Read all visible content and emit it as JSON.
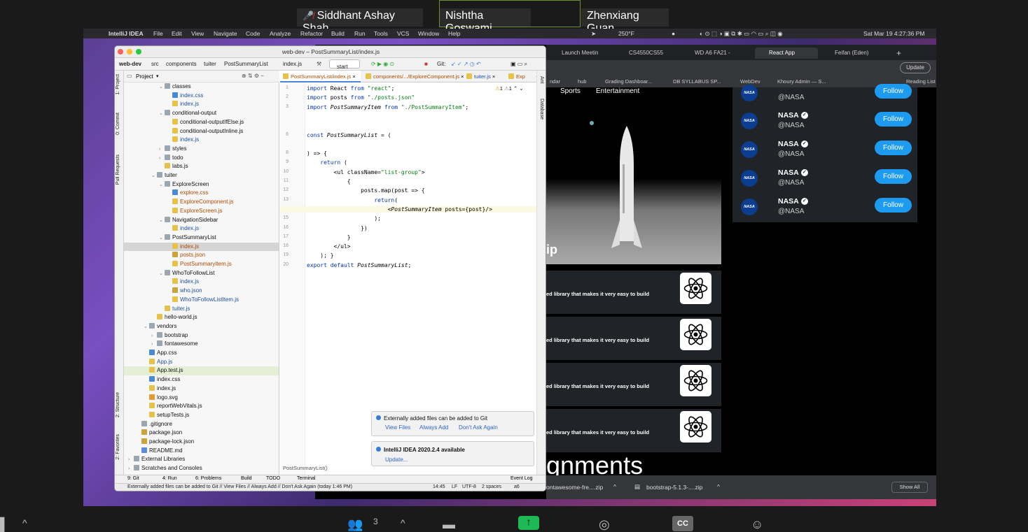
{
  "participants": [
    "Siddhant Ashay Shah",
    "Nishtha Goswami",
    "Zhenxiang Guan"
  ],
  "menubar": {
    "app": "IntelliJ IDEA",
    "items": [
      "File",
      "Edit",
      "View",
      "Navigate",
      "Code",
      "Analyze",
      "Refactor",
      "Build",
      "Run",
      "Tools",
      "VCS",
      "Window",
      "Help"
    ],
    "temp": "250°F",
    "clock": "Sat Mar 19  4:27:36 PM"
  },
  "chrome": {
    "tabs": [
      "Launch Meetin",
      "CS4550CS55",
      "WD A6 FA21 -",
      "React App",
      "Feifan (Eden)"
    ],
    "update": "Update",
    "bookmarks": [
      "ndar",
      "hub",
      "Grading Dashboar...",
      "DB SYLLABUS SP...",
      "WebDev",
      "Khoury Admin — S...",
      "Reading List"
    ],
    "nav_items": [
      "Sports",
      "Entertainment"
    ],
    "heading_fragment": "ip",
    "assign_fragment": "gnments",
    "react_text": "ed library that makes it very easy to build",
    "who": [
      {
        "name": "NASA",
        "handle": "@NASA",
        "follow": "Follow"
      },
      {
        "name": "NASA",
        "handle": "@NASA",
        "follow": "Follow"
      },
      {
        "name": "NASA",
        "handle": "@NASA",
        "follow": "Follow"
      },
      {
        "name": "NASA",
        "handle": "@NASA",
        "follow": "Follow"
      },
      {
        "name": "NASA",
        "handle": "@NASA",
        "follow": "Follow"
      }
    ],
    "nasa_logo_text": "NASA",
    "downloads": [
      "ontawesome-fre....zip",
      "bootstrap-5.1.3-....zip"
    ],
    "show_all": "Show All"
  },
  "ij": {
    "title": "web-dev – PostSummaryList/index.js",
    "breadcrumb": [
      "web-dev",
      "src",
      "components",
      "tuiter",
      "PostSummaryList",
      "index.js"
    ],
    "run_config": "start",
    "git_label": "Git:",
    "project_label": "Project",
    "tree": [
      {
        "label": "classes",
        "type": "folder",
        "indent": 4,
        "open": true
      },
      {
        "label": "index.css",
        "type": "css",
        "indent": 5,
        "color": "#2050a0"
      },
      {
        "label": "index.js",
        "type": "js",
        "indent": 5,
        "color": "#2050a0"
      },
      {
        "label": "conditional-output",
        "type": "folder",
        "indent": 4,
        "open": true
      },
      {
        "label": "conditional-outputIfElse.js",
        "type": "js",
        "indent": 5
      },
      {
        "label": "conditional-outputInline.js",
        "type": "js",
        "indent": 5
      },
      {
        "label": "index.js",
        "type": "js",
        "indent": 5,
        "color": "#2050a0"
      },
      {
        "label": "styles",
        "type": "folder",
        "indent": 4,
        "open": false
      },
      {
        "label": "todo",
        "type": "folder",
        "indent": 4,
        "open": false
      },
      {
        "label": "labs.js",
        "type": "js",
        "indent": 4
      },
      {
        "label": "tuiter",
        "type": "folder",
        "indent": 3,
        "open": true
      },
      {
        "label": "ExploreScreen",
        "type": "folder",
        "indent": 4,
        "open": true
      },
      {
        "label": "explore.css",
        "type": "css",
        "indent": 5,
        "color": "#b04a00"
      },
      {
        "label": "ExploreComponent.js",
        "type": "js",
        "indent": 5,
        "color": "#b04a00"
      },
      {
        "label": "ExploreScreen.js",
        "type": "js",
        "indent": 5,
        "color": "#b04a00"
      },
      {
        "label": "NavigationSidebar",
        "type": "folder",
        "indent": 4,
        "open": true
      },
      {
        "label": "index.js",
        "type": "js",
        "indent": 5,
        "color": "#2050a0"
      },
      {
        "label": "PostSummaryList",
        "type": "folder",
        "indent": 4,
        "open": true
      },
      {
        "label": "index.js",
        "type": "js",
        "indent": 5,
        "color": "#b04a00",
        "selected": true
      },
      {
        "label": "posts.json",
        "type": "json",
        "indent": 5,
        "color": "#b04a00"
      },
      {
        "label": "PostSummaryItem.js",
        "type": "js",
        "indent": 5,
        "color": "#b04a00"
      },
      {
        "label": "WhoToFollowList",
        "type": "folder",
        "indent": 4,
        "open": true
      },
      {
        "label": "index.js",
        "type": "js",
        "indent": 5,
        "color": "#2050a0"
      },
      {
        "label": "who.json",
        "type": "json",
        "indent": 5,
        "color": "#2050a0"
      },
      {
        "label": "WhoToFollowListItem.js",
        "type": "js",
        "indent": 5,
        "color": "#2050a0"
      },
      {
        "label": "tuiter.js",
        "type": "js",
        "indent": 4,
        "color": "#2050a0"
      },
      {
        "label": "hello-world.js",
        "type": "js",
        "indent": 3
      },
      {
        "label": "vendors",
        "type": "folder",
        "indent": 2,
        "open": true
      },
      {
        "label": "bootstrap",
        "type": "folder",
        "indent": 3,
        "open": false
      },
      {
        "label": "fontawesome",
        "type": "folder",
        "indent": 3,
        "open": false
      },
      {
        "label": "App.css",
        "type": "css",
        "indent": 2
      },
      {
        "label": "App.js",
        "type": "js",
        "indent": 2,
        "color": "#2050a0"
      },
      {
        "label": "App.test.js",
        "type": "js",
        "indent": 2,
        "highlight": true
      },
      {
        "label": "index.css",
        "type": "css",
        "indent": 2
      },
      {
        "label": "index.js",
        "type": "js",
        "indent": 2
      },
      {
        "label": "logo.svg",
        "type": "svg",
        "indent": 2
      },
      {
        "label": "reportWebVitals.js",
        "type": "js",
        "indent": 2
      },
      {
        "label": "setupTests.js",
        "type": "js",
        "indent": 2
      },
      {
        "label": ".gitignore",
        "type": "file",
        "indent": 1
      },
      {
        "label": "package.json",
        "type": "json",
        "indent": 1
      },
      {
        "label": "package-lock.json",
        "type": "json",
        "indent": 1
      },
      {
        "label": "README.md",
        "type": "md",
        "indent": 1
      },
      {
        "label": "External Libraries",
        "type": "lib",
        "indent": 0,
        "open": false
      },
      {
        "label": "Scratches and Consoles",
        "type": "lib",
        "indent": 0,
        "open": false
      }
    ],
    "tabs": [
      "PostSummaryList/index.js",
      "components/.../ExploreComponent.js",
      "tuiter.js",
      "Exp"
    ],
    "warnings": "1",
    "errors": "1",
    "line_numbers": [
      "1",
      "2",
      "3",
      "",
      "",
      "6",
      "",
      "8",
      "9",
      "10",
      "11",
      "12",
      "13",
      "14",
      "15",
      "16",
      "17",
      "18",
      "19",
      "20"
    ],
    "code_lines": [
      "import React from \"react\";",
      "import posts from \"./posts.json\"",
      "import PostSummaryItem from \"./PostSummaryItem\";",
      "",
      "",
      "const PostSummaryList = (",
      "",
      ") => {",
      "    return (",
      "        <ul className=\"list-group\">",
      "            {",
      "                posts.map(post => {",
      "                    return(",
      "                        <PostSummaryItem posts={post}/>",
      "                    );",
      "                })",
      "            }",
      "        </ul>",
      "    ); }",
      "export default PostSummaryList;"
    ],
    "editor_breadcrumb": "PostSummaryList()",
    "notif1": {
      "text": "Externally added files can be added to Git",
      "links": [
        "View Files",
        "Always Add",
        "Don't Ask Again"
      ]
    },
    "notif2": {
      "text": "IntelliJ IDEA 2020.2.4 available",
      "link": "Update..."
    },
    "side_left": [
      "1: Project",
      "0: Commit",
      "Pull Requests",
      "2: Structure",
      "2: Favorites"
    ],
    "side_right": [
      "Ant",
      "Database"
    ],
    "bottom_tools": [
      "9: Git",
      "4: Run",
      "6: Problems",
      "Build",
      "TODO",
      "Terminal",
      "Event Log"
    ],
    "status": {
      "message": "Externally added files can be added to Git // View Files // Always Add // Don't Ask Again (today 1:46 PM)",
      "position": "14:45",
      "le": "LF",
      "enc": "UTF-8",
      "indent": "2 spaces",
      "branch": "a6"
    }
  },
  "zoom": {
    "participants_count": "3"
  }
}
